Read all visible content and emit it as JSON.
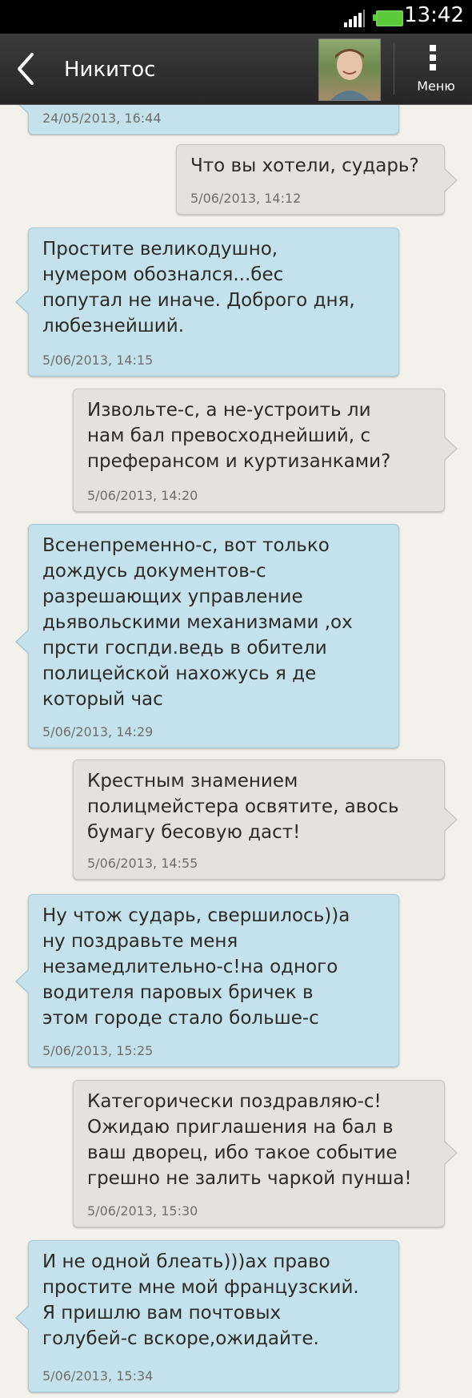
{
  "status_bar": {
    "time": "13:42"
  },
  "header": {
    "contact_name": "Никитос",
    "menu_label": "Меню"
  },
  "messages": [
    {
      "direction": "in",
      "text": "",
      "time": "24/05/2013, 16:44"
    },
    {
      "direction": "out",
      "text": "Что вы хотели, сударь?",
      "time": "5/06/2013, 14:12"
    },
    {
      "direction": "in",
      "text": "Простите великодушно,\nнумером обознался...бес\nпопутал не иначе. Доброго дня,\nлюбезнейший.",
      "time": "5/06/2013, 14:15"
    },
    {
      "direction": "out",
      "text": "Извольте-с, а не-устроить ли\nнам бал превосходнейший, с\nпреферансом и куртизанками?",
      "time": "5/06/2013, 14:20"
    },
    {
      "direction": "in",
      "text": "Всенепременно-с, вот только\nдождусь документов-с\nразрешающих управление\nдьявольскими механизмами ,ох\nпрсти госпди.ведь в обители\nполицейской нахожусь я де\nкоторый час",
      "time": "5/06/2013, 14:29"
    },
    {
      "direction": "out",
      "text": "Крестным знамением\nполицмейстера освятите, авось\nбумагу бесовую даст!",
      "time": "5/06/2013, 14:55"
    },
    {
      "direction": "in",
      "text": "Ну чтож сударь, свершилось))а\nну поздравьте меня\nнезамедлительно-с!на одного\nводителя паровых бричек в\nэтом городе стало больше-с",
      "time": "5/06/2013, 15:25"
    },
    {
      "direction": "out",
      "text": "Категорически поздравляю-с!\nОжидаю приглашения на бал в\nваш дворец, ибо такое событие\nгрешно не залить чаркой пунша!",
      "time": "5/06/2013, 15:30"
    },
    {
      "direction": "in",
      "text": "И не одной блеать)))ах право\nпростите мне мой французский.\nЯ пришлю вам почтовых\nголубей-с вскоре,ожидайте.",
      "time": "5/06/2013, 15:34"
    }
  ]
}
